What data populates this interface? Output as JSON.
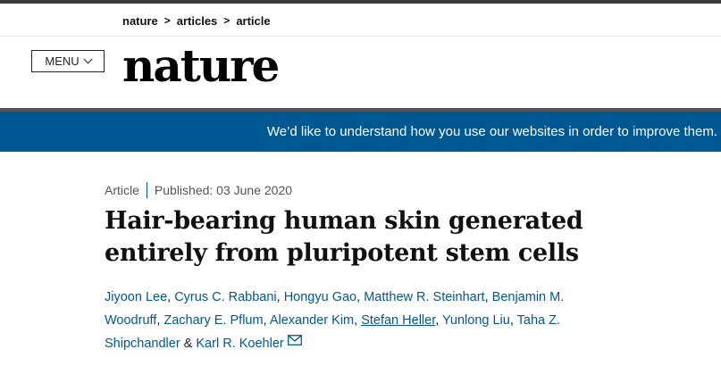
{
  "breadcrumb": {
    "items": [
      "nature",
      "articles",
      "article"
    ],
    "separator": ">"
  },
  "header": {
    "menu_label": "MENU",
    "logo_text": "nature"
  },
  "banner": {
    "text": "We’d like to understand how you use our websites in order to improve them."
  },
  "article": {
    "type": "Article",
    "published": "Published: 03 June 2020",
    "title_line1": "Hair-bearing human skin generated",
    "title_line2": "entirely from pluripotent stem cells",
    "authors": {
      "a1": "Jiyoon Lee",
      "a2": "Cyrus C. Rabbani",
      "a3": "Hongyu Gao",
      "a4": "Matthew R. Steinhart",
      "a5": "Benjamin M. Woodruff",
      "a6": "Zachary E. Pflum",
      "a7": "Alexander Kim",
      "a8": "Stefan Heller",
      "a9": "Yunlong Liu",
      "a10": "Taha Z. Shipchandler",
      "a11": "Karl R. Koehler",
      "comma": ", ",
      "amp": " & "
    }
  },
  "colors": {
    "banner_bg": "#005892",
    "author_link": "#005892"
  }
}
